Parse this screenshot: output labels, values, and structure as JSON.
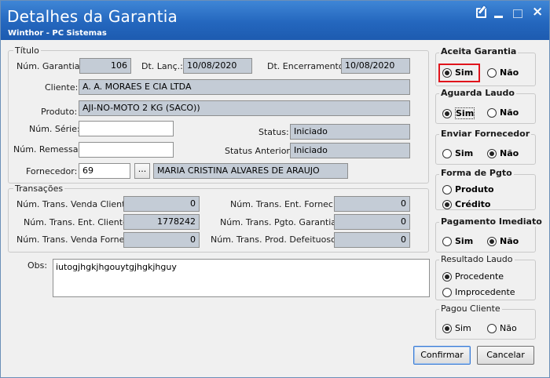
{
  "window": {
    "title": "Detalhes da Garantia",
    "subtitle": "Winthor - PC Sistemas",
    "close_glyph": "×"
  },
  "titulo": {
    "group_label": "Título",
    "num_garantia_label": "Núm. Garantia:",
    "num_garantia": "106",
    "dt_lanc_label": "Dt. Lanç.:",
    "dt_lanc": "10/08/2020",
    "dt_encerramento_label": "Dt. Encerramento:",
    "dt_encerramento": "10/08/2020",
    "cliente_label": "Cliente:",
    "cliente": "A. A. MORAES E CIA LTDA",
    "produto_label": "Produto:",
    "produto": "AJI-NO-MOTO 2 KG (SACO))",
    "num_serie_label": "Núm. Série:",
    "num_serie": "",
    "status_label": "Status:",
    "status": "Iniciado",
    "num_remessa_label": "Núm. Remessa:",
    "num_remessa": "",
    "status_anterior_label": "Status Anterior:",
    "status_anterior": "Iniciado",
    "fornecedor_label": "Fornecedor:",
    "fornecedor_code": "69",
    "fornecedor_button": "...",
    "fornecedor_name": "MARIA CRISTINA ALVARES DE ARAUJO"
  },
  "transacoes": {
    "group_label": "Transações",
    "venda_cliente_label": "Núm. Trans. Venda Cliente:",
    "venda_cliente": "0",
    "ent_fornec_label": "Núm. Trans. Ent. Fornec:",
    "ent_fornec": "0",
    "ent_cliente_label": "Núm. Trans. Ent. Cliente:",
    "ent_cliente": "1778242",
    "pgto_garantia_label": "Núm. Trans. Pgto. Garantia:",
    "pgto_garantia": "0",
    "venda_fornec_label": "Núm. Trans. Venda Fornec:",
    "venda_fornec": "0",
    "prod_defeituoso_label": "Núm. Trans. Prod. Defeituoso:",
    "prod_defeituoso": "0"
  },
  "obs": {
    "label": "Obs:",
    "value": "iutogjhgkjhgouytgjhgkjhguy"
  },
  "sidebar": {
    "aceita_garantia": {
      "title": "Aceita Garantia",
      "opt1": "Sim",
      "opt2": "Não",
      "selected": "Sim"
    },
    "aguarda_laudo": {
      "title": "Aguarda Laudo",
      "opt1": "Sim",
      "opt2": "Não",
      "selected": "Sim"
    },
    "enviar_fornecedor": {
      "title": "Enviar Fornecedor",
      "opt1": "Sim",
      "opt2": "Não",
      "selected": "Não"
    },
    "forma_pgto": {
      "title": "Forma de Pgto",
      "opt1": "Produto",
      "opt2": "Crédito",
      "selected": "Crédito"
    },
    "pagamento_imediato": {
      "title": "Pagamento Imediato",
      "opt1": "Sim",
      "opt2": "Não",
      "selected": "Não"
    },
    "resultado_laudo": {
      "title": "Resultado Laudo",
      "opt1": "Procedente",
      "opt2": "Improcedente",
      "selected": "Procedente"
    },
    "pagou_cliente": {
      "title": "Pagou Cliente",
      "opt1": "Sim",
      "opt2": "Não",
      "selected": "Sim"
    }
  },
  "actions": {
    "confirmar": "Confirmar",
    "cancelar": "Cancelar"
  },
  "colors": {
    "titlebar": "#2467be",
    "readonly_field": "#c4ccd6",
    "highlight": "#e0141c"
  }
}
